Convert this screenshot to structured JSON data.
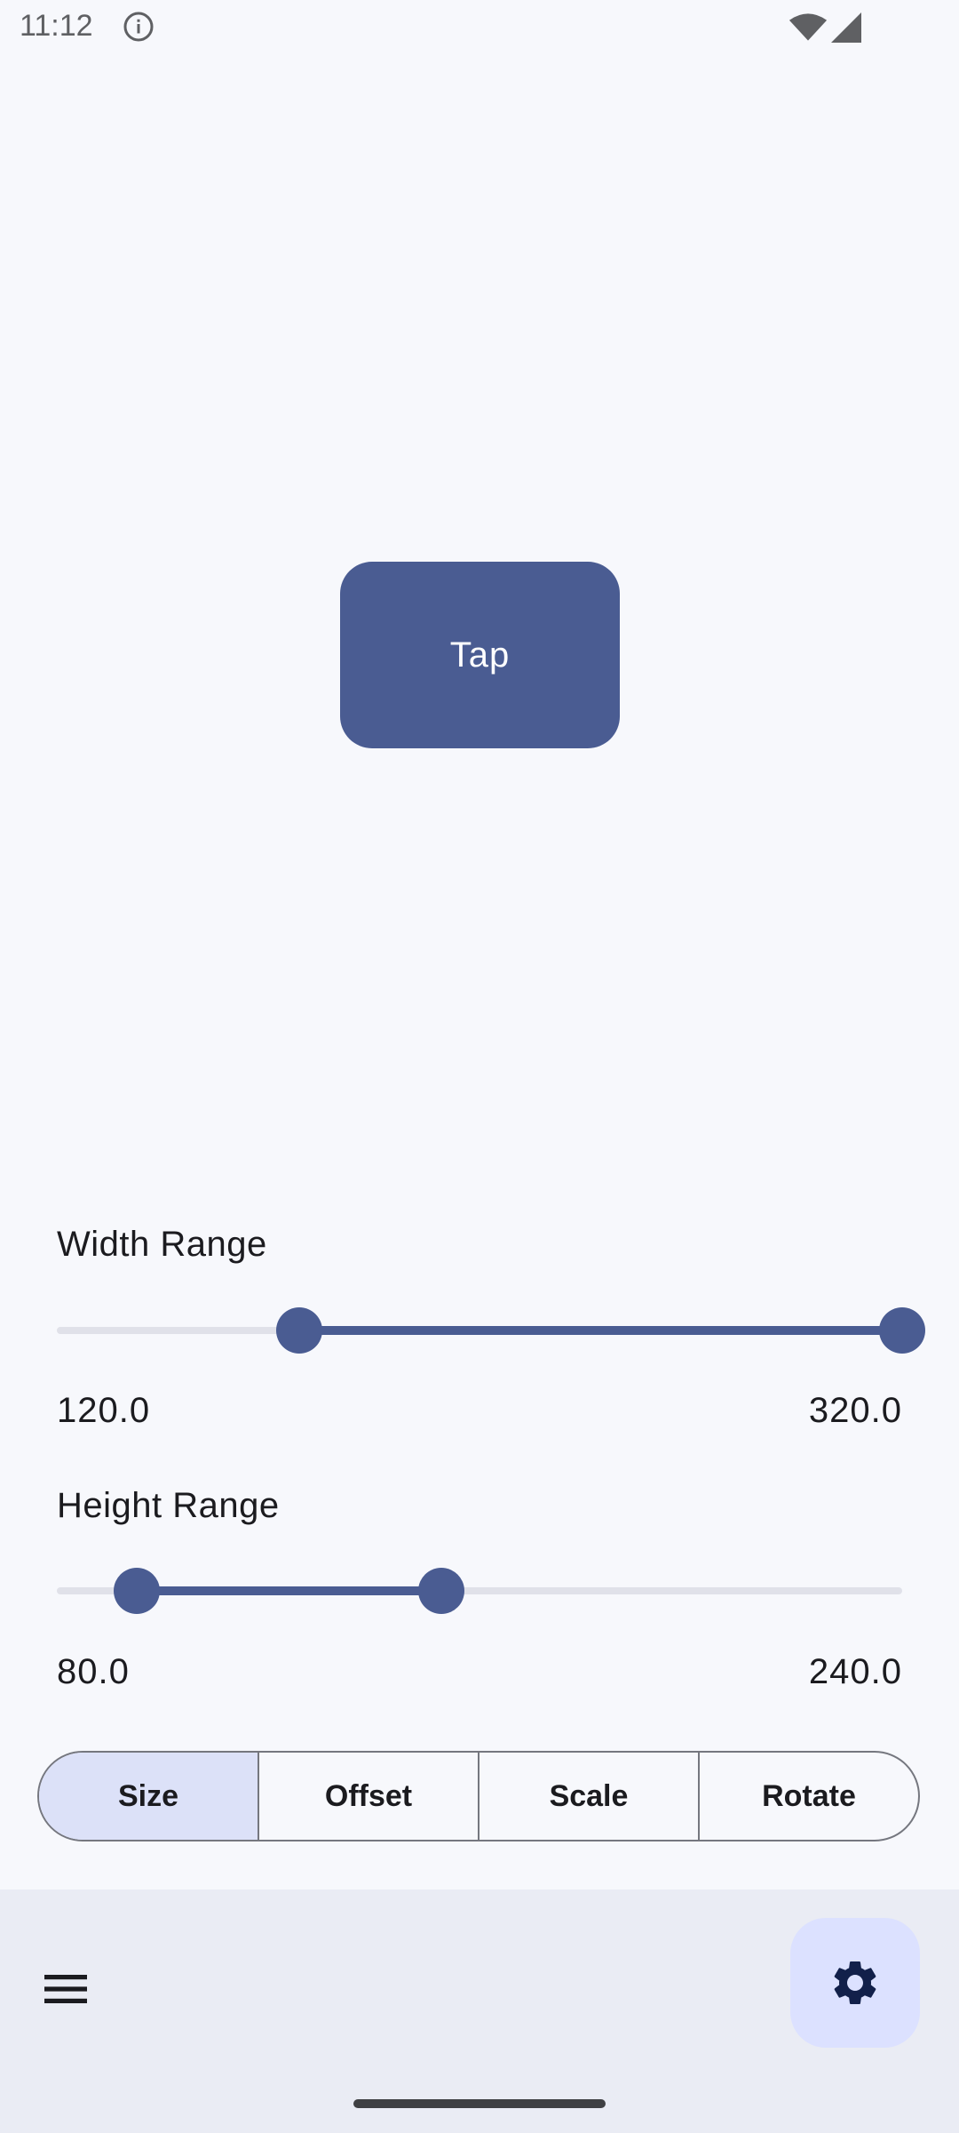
{
  "status_bar": {
    "time": "11:12",
    "icons": [
      "info-icon",
      "wifi-icon",
      "signal-icon"
    ]
  },
  "main": {
    "tap_button_label": "Tap"
  },
  "width_slider": {
    "label": "Width Range",
    "min": 0,
    "max": 1,
    "start_fraction": 0.287,
    "end_fraction": 1.0,
    "start_value": "120.0",
    "end_value": "320.0"
  },
  "height_slider": {
    "label": "Height Range",
    "start_fraction": 0.095,
    "end_fraction": 0.455,
    "start_value": "80.0",
    "end_value": "240.0"
  },
  "segments": {
    "items": [
      "Size",
      "Offset",
      "Scale",
      "Rotate"
    ],
    "selected": "Size"
  },
  "bottom_bar": {
    "menu_icon": "menu-icon",
    "fab_icon": "gear-icon"
  },
  "colors": {
    "primary": "#4a5c92",
    "background": "#f7f8fc",
    "segment_selected": "#dce1f8",
    "bottom_bar": "#eaecf4",
    "fab": "#dce1ff"
  }
}
